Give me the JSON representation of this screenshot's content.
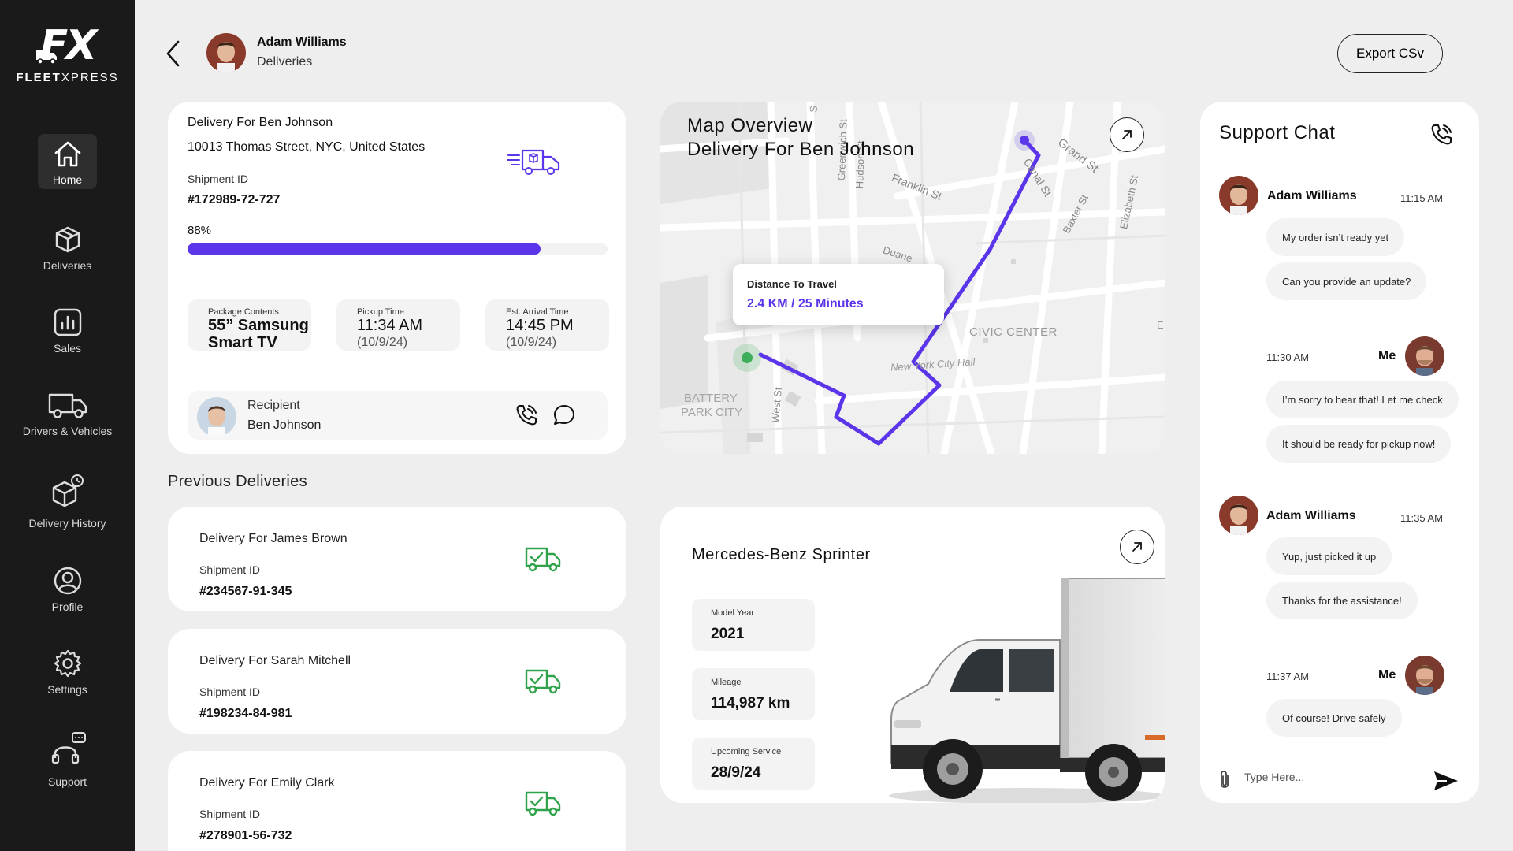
{
  "brand": {
    "mark": "FX",
    "name_bold": "FLEET",
    "name_rest": "XPRESS"
  },
  "sidebar": {
    "items": [
      {
        "label": "Home",
        "icon": "home-icon"
      },
      {
        "label": "Deliveries",
        "icon": "box-icon"
      },
      {
        "label": "Sales",
        "icon": "bar-chart-icon"
      },
      {
        "label": "Drivers & Vehicles",
        "icon": "truck-icon"
      },
      {
        "label": "Delivery History",
        "icon": "box-history-icon"
      },
      {
        "label": "Profile",
        "icon": "user-icon"
      },
      {
        "label": "Settings",
        "icon": "gear-icon"
      },
      {
        "label": "Support",
        "icon": "headset-icon"
      }
    ]
  },
  "header": {
    "name": "Adam Williams",
    "subtitle": "Deliveries",
    "export_label": "Export CSv"
  },
  "current_delivery": {
    "title": "Delivery For Ben Johnson",
    "address": "10013 Thomas Street, NYC, United States",
    "shipment_label": "Shipment ID",
    "shipment_id": "#172989-72-727",
    "progress_text": "88%",
    "progress": 0.84,
    "package_label": "Package Contents",
    "package_value": "55” Samsung Smart TV",
    "pickup_label": "Pickup Time",
    "pickup_time": "11:34 AM",
    "pickup_date": "(10/9/24)",
    "arrival_label": "Est. Arrival Time",
    "arrival_time": "14:45 PM",
    "arrival_date": "(10/9/24)",
    "recipient_label": "Recipient",
    "recipient_name": "Ben Johnson"
  },
  "previous": {
    "title": "Previous Deliveries",
    "items": [
      {
        "title": "Delivery For James Brown",
        "shipment_label": "Shipment ID",
        "shipment_id": "#234567-91-345"
      },
      {
        "title": "Delivery For Sarah Mitchell",
        "shipment_label": "Shipment ID",
        "shipment_id": "#198234-84-981"
      },
      {
        "title": "Delivery For Emily Clark",
        "shipment_label": "Shipment ID",
        "shipment_id": "#278901-56-732"
      }
    ]
  },
  "map": {
    "title_line1": "Map Overview",
    "title_line2": "Delivery For Ben Johnson",
    "popup_label": "Distance To Travel",
    "popup_value": "2.4 KM / 25 Minutes",
    "streets": [
      "Grand St",
      "Canal St",
      "Franklin St",
      "Hudson St",
      "Greenwich St",
      "Baxter St",
      "Elizabeth St",
      "Duane",
      "West St",
      "CIVIC CENTER",
      "New York City Hall",
      "BATTERY",
      "PARK CITY",
      "S",
      "E"
    ]
  },
  "vehicle": {
    "title": "Mercedes-Benz Sprinter",
    "year_label": "Model Year",
    "year": "2021",
    "mileage_label": "Mileage",
    "mileage": "114,987 km",
    "service_label": "Upcoming Service",
    "service": "28/9/24"
  },
  "chat": {
    "title": "Support Chat",
    "groups": [
      {
        "sender": "Adam Williams",
        "time": "11:15 AM",
        "messages": [
          "My order isn’t ready yet",
          "Can you provide an update?"
        ]
      },
      {
        "sender": "Me",
        "time": "11:30 AM",
        "messages": [
          "I’m sorry to hear that! Let me check",
          "It should be ready for pickup now!"
        ]
      },
      {
        "sender": "Adam Williams",
        "time": "11:35 AM",
        "messages": [
          "Yup, just picked it up",
          "Thanks for the assistance!"
        ]
      },
      {
        "sender": "Me",
        "time": "11:37 AM",
        "messages": [
          "Of course! Drive safely"
        ]
      }
    ],
    "input_placeholder": "Type Here..."
  },
  "colors": {
    "accent": "#5b35ea",
    "success": "#2fa24a",
    "sidebar": "#1a1a1a",
    "map_pin": "#3fae5a"
  }
}
